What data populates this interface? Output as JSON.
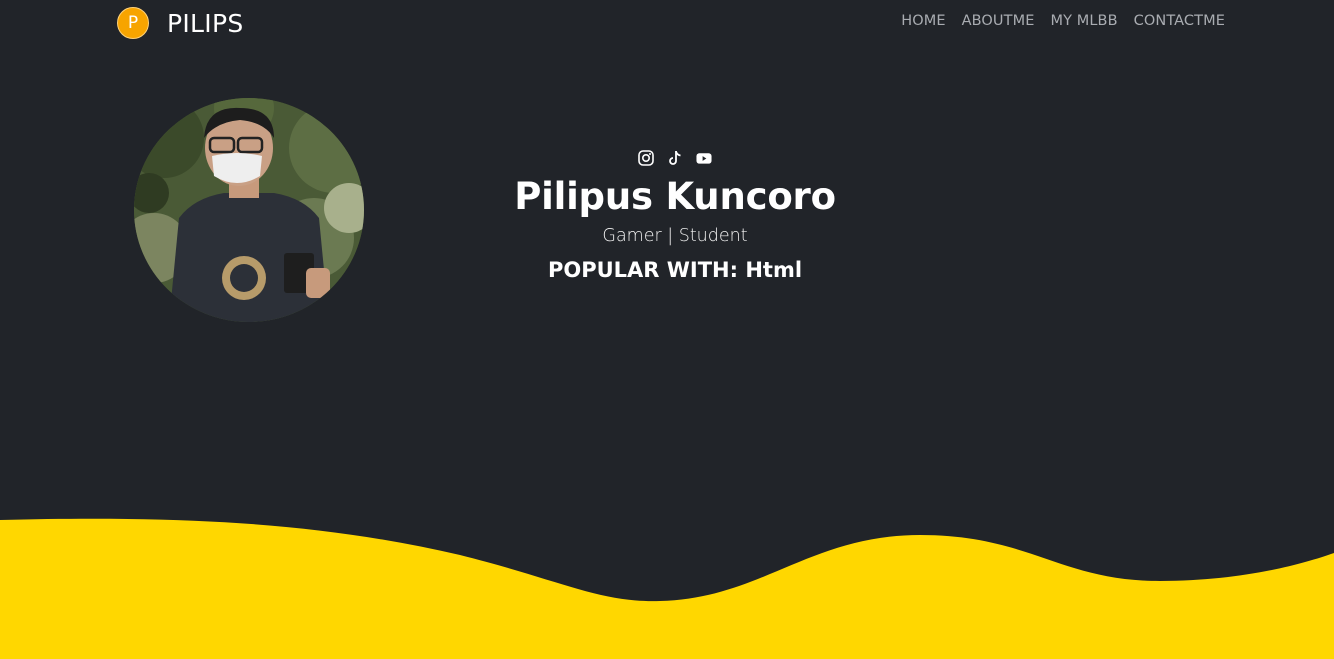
{
  "navbar": {
    "brand_letter": "P",
    "brand_name": "PILIPS",
    "links": [
      {
        "label": "HOME"
      },
      {
        "label": "ABOUTME"
      },
      {
        "label": "MY MLBB"
      },
      {
        "label": "CONTACTME"
      }
    ]
  },
  "hero": {
    "socials": [
      {
        "icon": "instagram-icon"
      },
      {
        "icon": "tiktok-icon"
      },
      {
        "icon": "youtube-icon"
      }
    ],
    "name": "Pilipus Kuncoro",
    "role": "Gamer | Student",
    "popular": "POPULAR WITH: Html"
  },
  "colors": {
    "background": "#212429",
    "wave": "#ffd700",
    "brand_logo": "#f7a400",
    "nav_link": "#a9acb1",
    "text": "#ffffff"
  }
}
